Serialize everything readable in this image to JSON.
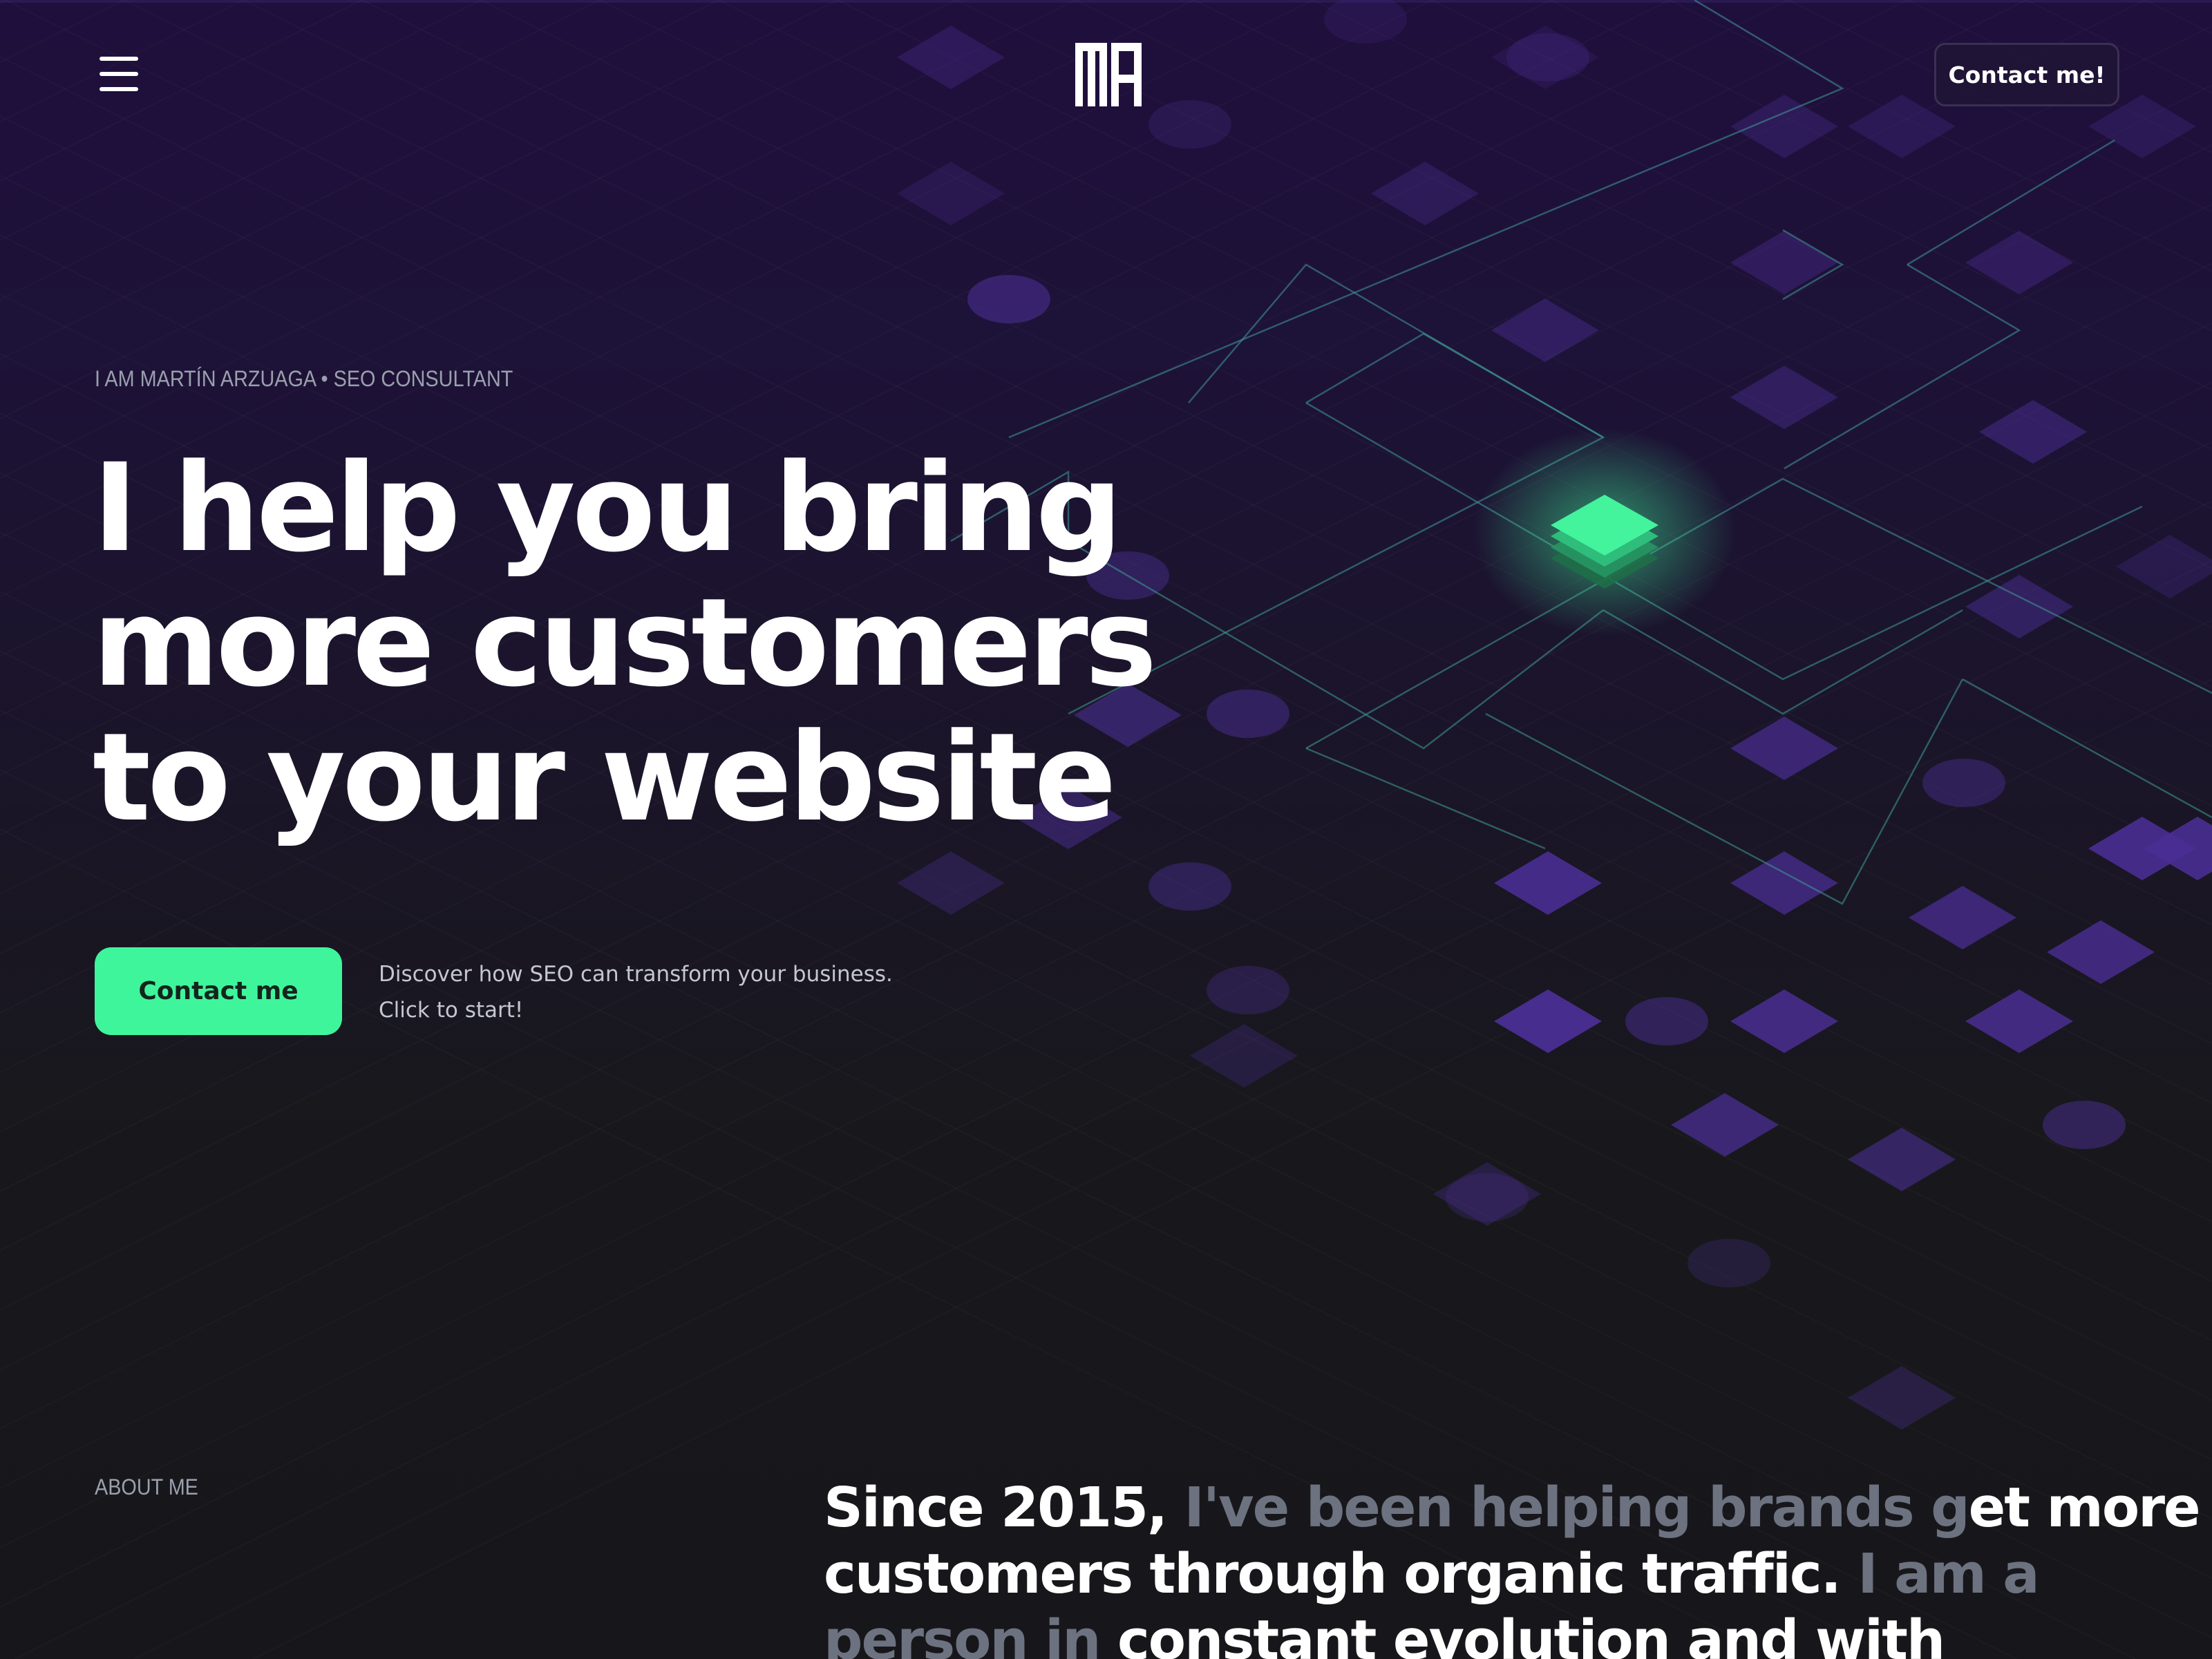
{
  "header": {
    "menu_icon": "hamburger-menu-icon",
    "logo_text": "MA",
    "contact_button": "Contact me!"
  },
  "hero": {
    "eyebrow": "I AM MARTÍN ARZUAGA • SEO CONSULTANT",
    "title_lines": [
      "I help you bring",
      "more customers",
      "to your website"
    ],
    "cta_label": "Contact me",
    "cta_description_lines": [
      "Discover how SEO can transform your business.",
      "Click to start!"
    ]
  },
  "about": {
    "label": "ABOUT ME",
    "line1": {
      "bright_a": "Since 2015, ",
      "dim": "I've been helping brands g",
      "bright_b": "et more"
    },
    "line2": {
      "bright": "customers through organic traffic. ",
      "dim": "I am a"
    },
    "line3": {
      "dim": "person in ",
      "bright": "constant evolution and with"
    }
  },
  "colors": {
    "accent": "#3ff59b",
    "background_top": "#1f0f3c",
    "background_bottom": "#17171b",
    "tile_purple": "#4a2e93",
    "circuit_line": "#3f9a96"
  }
}
